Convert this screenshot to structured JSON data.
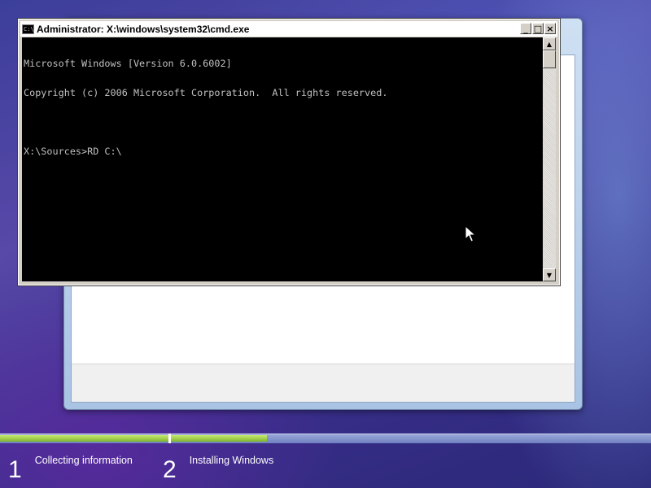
{
  "cmd_window": {
    "title": "Administrator: X:\\windows\\system32\\cmd.exe",
    "icon_text": "C:\\",
    "buttons": {
      "minimize": "_",
      "maximize": "□",
      "close": "×"
    },
    "console_lines": [
      "Microsoft Windows [Version 6.0.6002]",
      "Copyright (c) 2006 Microsoft Corporation.  All rights reserved.",
      "",
      "X:\\Sources>RD C:\\"
    ],
    "scroll_up": "▲",
    "scroll_down": "▼"
  },
  "setup_progress": {
    "steps": [
      {
        "number": "1",
        "label": "Collecting information",
        "progress": 1.0
      },
      {
        "number": "2",
        "label": "Installing Windows",
        "progress": 0.2
      }
    ]
  },
  "colors": {
    "progress_fill": "#9ccd3c",
    "console_text": "#c0c0c0",
    "console_bg": "#000000"
  }
}
